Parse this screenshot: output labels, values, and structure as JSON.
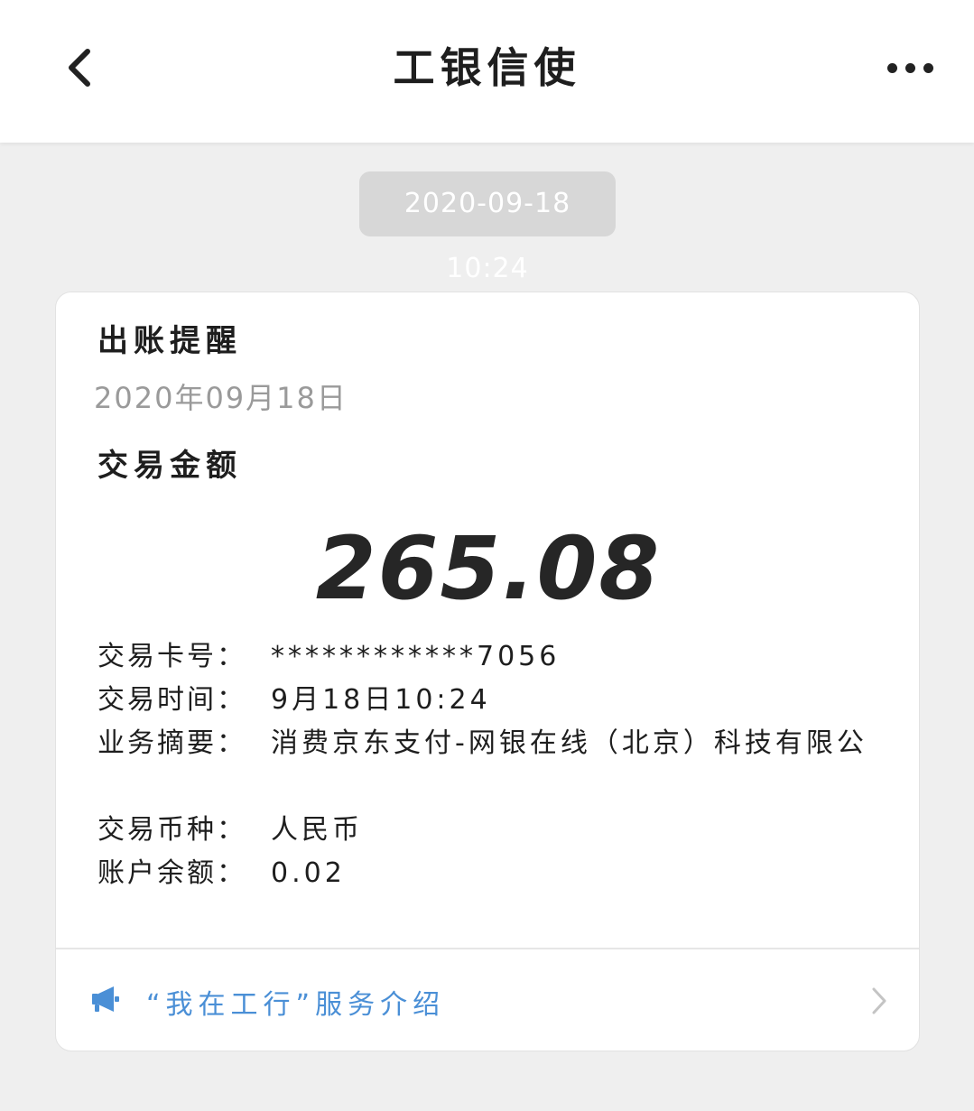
{
  "header": {
    "title": "工银信使",
    "back_icon": "chevron-left-icon",
    "more_icon": "more-horizontal-icon"
  },
  "timestamp": "2020-09-18 10:24",
  "card": {
    "title": "出账提醒",
    "date": "2020年09月18日",
    "amount_label": "交易金额",
    "amount": "265.08",
    "details": [
      {
        "label": "交易卡号：",
        "value": "************7056"
      },
      {
        "label": "交易时间：",
        "value": "9月18日10:24"
      },
      {
        "label": "业务摘要：",
        "value": "消费京东支付-网银在线（北京）科技有限公"
      },
      {
        "label": "交易币种：",
        "value": "人民币"
      },
      {
        "label": "账户余额：",
        "value": "0.02"
      }
    ],
    "footer_link": "“我在工行”服务介绍",
    "footer_icon": "megaphone-icon",
    "footer_chevron": "chevron-right-icon"
  },
  "colors": {
    "background": "#efefef",
    "link": "#4a8fd6",
    "timestamp_bg": "#d7d7d7"
  }
}
